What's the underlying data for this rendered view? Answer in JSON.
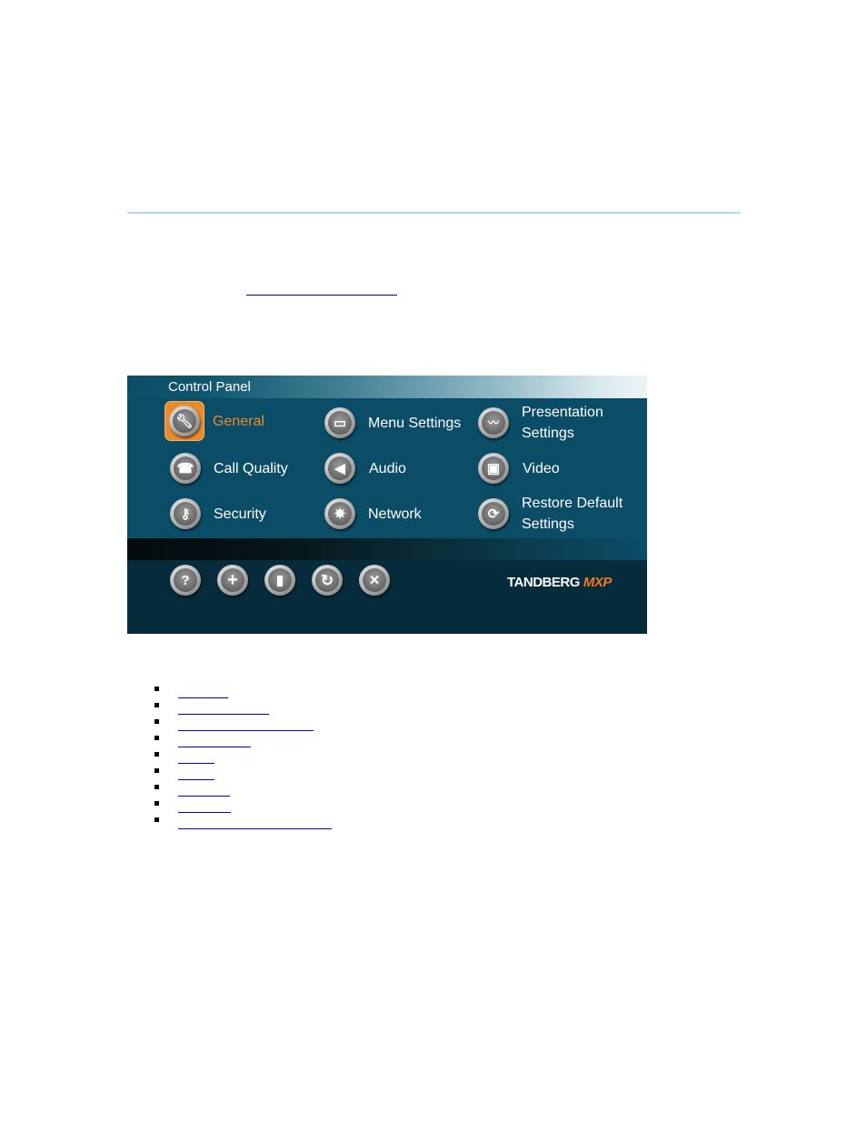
{
  "page": {
    "intro_link": ""
  },
  "control_panel": {
    "title": "Control Panel",
    "items": [
      {
        "label": "General",
        "icon": "wrench-icon",
        "selected": true
      },
      {
        "label": "Menu Settings",
        "icon": "monitor-icon",
        "selected": false
      },
      {
        "label": "Presentation\nSettings",
        "icon": "presentation-graph-icon",
        "selected": false
      },
      {
        "label": "Call Quality",
        "icon": "phone-handset-icon",
        "selected": false
      },
      {
        "label": "Audio",
        "icon": "speaker-icon",
        "selected": false
      },
      {
        "label": "Video",
        "icon": "video-picture-icon",
        "selected": false
      },
      {
        "label": "Security",
        "icon": "key-icon",
        "selected": false
      },
      {
        "label": "Network",
        "icon": "network-web-icon",
        "selected": false
      },
      {
        "label": "Restore Default\nSettings",
        "icon": "restore-arrows-icon",
        "selected": false
      }
    ],
    "toolbar": [
      {
        "name": "help-button",
        "icon": "question-mark-icon",
        "glyph": "?"
      },
      {
        "name": "add-button",
        "icon": "plus-icon",
        "glyph": "+"
      },
      {
        "name": "film-button",
        "icon": "filmstrip-icon",
        "glyph": "▮"
      },
      {
        "name": "refresh-button",
        "icon": "refresh-icon",
        "glyph": "↻"
      },
      {
        "name": "close-button",
        "icon": "close-x-icon",
        "glyph": "✕"
      }
    ],
    "brand": {
      "name": "TANDBERG",
      "product": "MXP"
    },
    "colors": {
      "panel_background": "#0b4c66",
      "selected_accent": "#e98a2d",
      "selected_text": "#f08a2c",
      "brand_accent": "#f07a1a"
    }
  },
  "toc_links": [
    "",
    "",
    "",
    "",
    "",
    "",
    "",
    "",
    ""
  ]
}
